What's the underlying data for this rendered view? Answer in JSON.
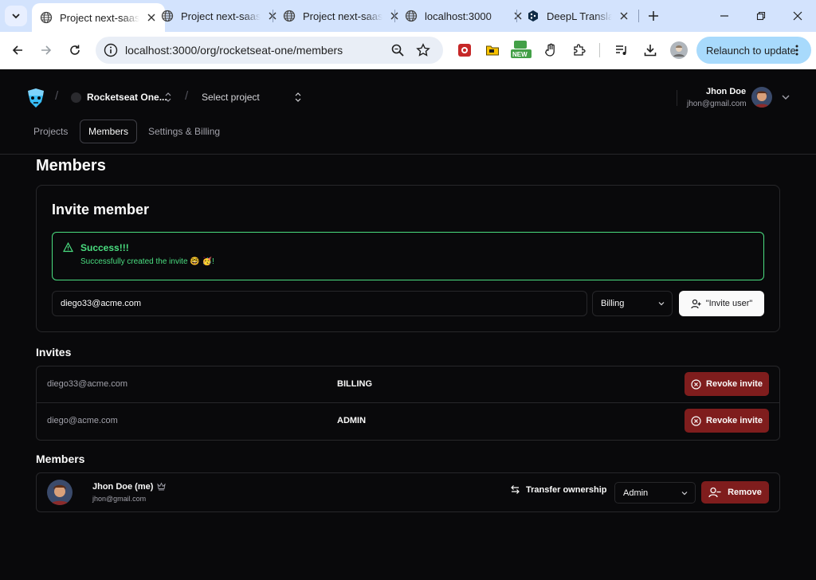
{
  "browser": {
    "tabs": [
      {
        "title": "Project next-saas",
        "active": true
      },
      {
        "title": "Project next-saas",
        "active": false
      },
      {
        "title": "Project next-saas",
        "active": false
      },
      {
        "title": "localhost:3000",
        "active": false
      },
      {
        "title": "DeepL Translate",
        "active": false
      }
    ],
    "url": "localhost:3000/org/rocketseat-one/members",
    "relaunch_label": "Relaunch to update",
    "ext_badge": "NEW"
  },
  "header": {
    "org_name": "Rocketseat One...",
    "project_placeholder": "Select project",
    "user": {
      "name": "Jhon Doe",
      "email": "jhon@gmail.com"
    },
    "nav": [
      {
        "label": "Projects",
        "active": false
      },
      {
        "label": "Members",
        "active": true
      },
      {
        "label": "Settings & Billing",
        "active": false
      }
    ]
  },
  "main": {
    "page_title": "Members",
    "invite_card": {
      "title": "Invite member",
      "alert": {
        "title": "Success!!!",
        "message": "Successfully created the invite 🤓 🥳!"
      },
      "email_value": "diego33@acme.com",
      "role_value": "Billing",
      "button_label": "\"Invite user\""
    },
    "invites": {
      "title": "Invites",
      "rows": [
        {
          "email": "diego33@acme.com",
          "role": "BILLING",
          "action": "Revoke invite"
        },
        {
          "email": "diego@acme.com",
          "role": "ADMIN",
          "action": "Revoke invite"
        }
      ]
    },
    "members": {
      "title": "Members",
      "rows": [
        {
          "name": "Jhon Doe (me)",
          "email": "jhon@gmail.com",
          "transfer_label": "Transfer ownership",
          "role": "Admin",
          "remove_label": "Remove"
        }
      ]
    }
  },
  "colors": {
    "success": "#4ade80",
    "danger": "#7f1d1d",
    "background": "#09090b"
  }
}
